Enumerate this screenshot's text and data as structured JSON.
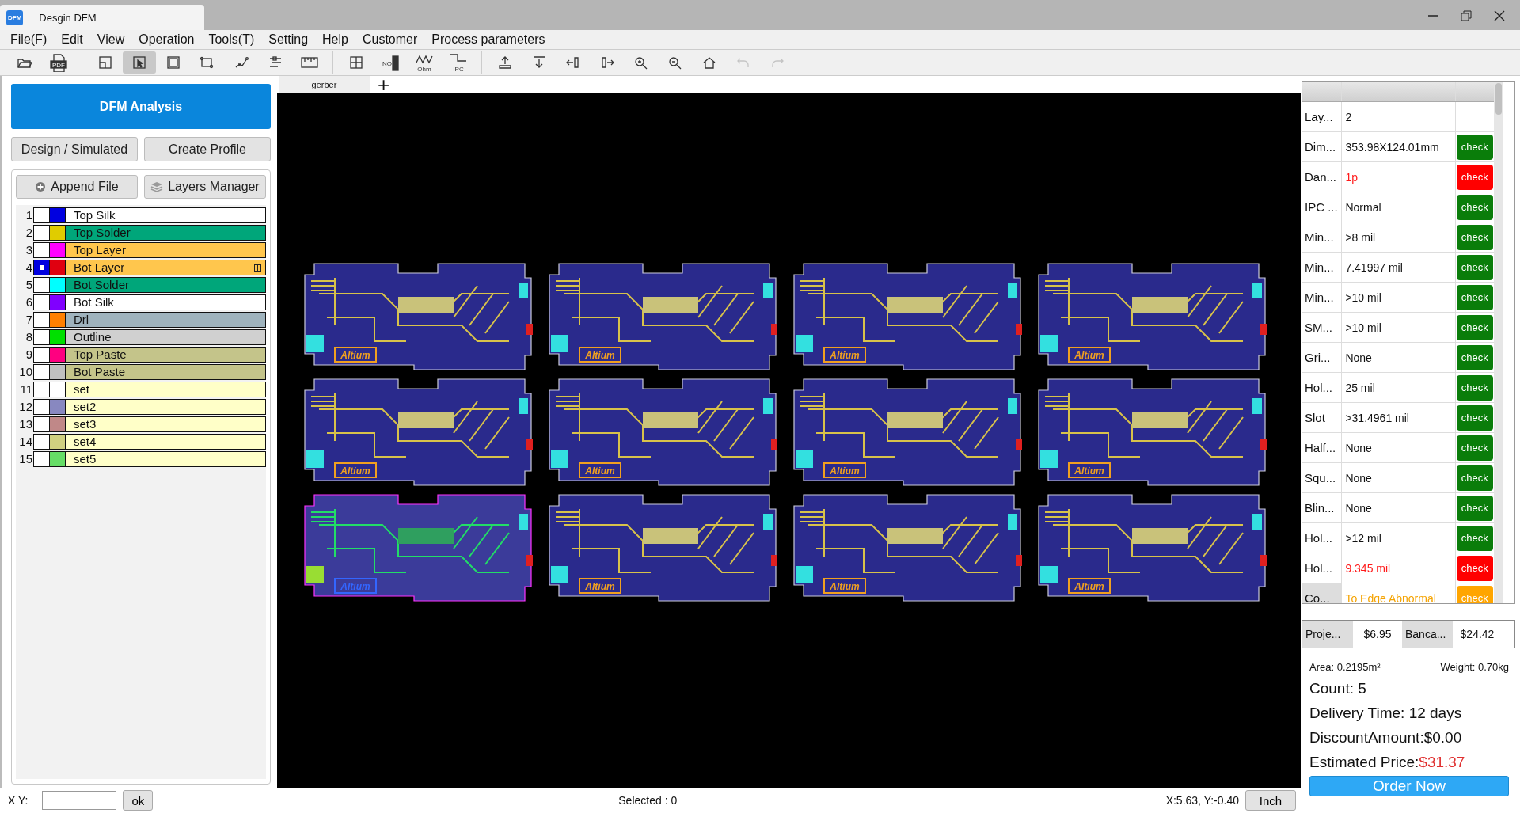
{
  "window": {
    "app_badge": "DFM",
    "title": "Desgin DFM"
  },
  "menu": [
    "File(F)",
    "Edit",
    "View",
    "Operation",
    "Tools(T)",
    "Setting",
    "Help",
    "Customer",
    "Process parameters"
  ],
  "toolbar": [
    [
      {
        "selected": false,
        "disabled": false
      },
      {
        "text": "PDF",
        "selected": false,
        "disabled": false
      }
    ],
    [
      {
        "selected": false,
        "disabled": false
      },
      {
        "selected": true,
        "disabled": false
      },
      {
        "selected": false,
        "disabled": false
      },
      {
        "selected": false,
        "disabled": false
      },
      {
        "selected": false,
        "disabled": false
      },
      {
        "selected": false,
        "disabled": false
      },
      {
        "selected": false,
        "disabled": false
      }
    ],
    [
      {
        "selected": false,
        "disabled": false
      },
      {
        "text": "NO",
        "selected": false,
        "disabled": false
      },
      {
        "text": "Ohm",
        "selected": false,
        "disabled": false
      },
      {
        "text": "IPC",
        "selected": false,
        "disabled": false
      }
    ],
    [
      {
        "selected": false,
        "disabled": false
      },
      {
        "selected": false,
        "disabled": false
      },
      {
        "selected": false,
        "disabled": false
      },
      {
        "selected": false,
        "disabled": false
      },
      {
        "selected": false,
        "disabled": false
      },
      {
        "selected": false,
        "disabled": false
      },
      {
        "selected": false,
        "disabled": false
      },
      {
        "selected": false,
        "disabled": true
      },
      {
        "selected": false,
        "disabled": true
      }
    ]
  ],
  "left_panel": {
    "primary_button": "DFM Analysis",
    "buttons": [
      "Design / Simulated",
      "Create Profile"
    ],
    "file_buttons": [
      "Append File",
      "Layers Manager"
    ],
    "layers": [
      {
        "number": "1",
        "name": "Top Silk",
        "color": "#0000e0",
        "kind": "silk",
        "selected": false,
        "expandable": false
      },
      {
        "number": "2",
        "name": "Top Solder",
        "color": "#e0cc00",
        "kind": "solder",
        "selected": false,
        "expandable": false
      },
      {
        "number": "3",
        "name": "Top Layer",
        "color": "#ff00ff",
        "kind": "copper",
        "selected": false,
        "expandable": false
      },
      {
        "number": "4",
        "name": "Bot Layer",
        "color": "#e00010",
        "kind": "copper",
        "selected": true,
        "expandable": true
      },
      {
        "number": "5",
        "name": "Bot Solder",
        "color": "#00ffff",
        "kind": "solder",
        "selected": false,
        "expandable": false
      },
      {
        "number": "6",
        "name": "Bot Silk",
        "color": "#8000ff",
        "kind": "silk",
        "selected": false,
        "expandable": false
      },
      {
        "number": "7",
        "name": "Drl",
        "color": "#ff8000",
        "kind": "drill",
        "selected": false,
        "expandable": false
      },
      {
        "number": "8",
        "name": "Outline",
        "color": "#00e000",
        "kind": "outline",
        "selected": false,
        "expandable": false
      },
      {
        "number": "9",
        "name": "Top Paste",
        "color": "#ff0080",
        "kind": "paste",
        "selected": false,
        "expandable": false
      },
      {
        "number": "10",
        "name": "Bot Paste",
        "color": "#c0c0c0",
        "kind": "paste",
        "selected": false,
        "expandable": false
      },
      {
        "number": "11",
        "name": "set",
        "color": "#ffffff",
        "kind": "set",
        "selected": false,
        "expandable": false
      },
      {
        "number": "12",
        "name": "set2",
        "color": "#8888c0",
        "kind": "set",
        "selected": false,
        "expandable": false
      },
      {
        "number": "13",
        "name": "set3",
        "color": "#c08888",
        "kind": "set",
        "selected": false,
        "expandable": false
      },
      {
        "number": "14",
        "name": "set4",
        "color": "#d0d080",
        "kind": "set",
        "selected": false,
        "expandable": false
      },
      {
        "number": "15",
        "name": "set5",
        "color": "#66dd66",
        "kind": "set",
        "selected": false,
        "expandable": false
      }
    ]
  },
  "canvas": {
    "tab": "gerber",
    "add_tab": "+",
    "boards": [
      {
        "label": "Altium",
        "selected": false
      },
      {
        "label": "Altium",
        "selected": false
      },
      {
        "label": "Altium",
        "selected": false
      },
      {
        "label": "Altium",
        "selected": false
      },
      {
        "label": "Altium",
        "selected": false
      },
      {
        "label": "Altium",
        "selected": false
      },
      {
        "label": "Altium",
        "selected": false
      },
      {
        "label": "Altium",
        "selected": false
      },
      {
        "label": "Altium",
        "selected": true
      },
      {
        "label": "Altium",
        "selected": false
      },
      {
        "label": "Altium",
        "selected": false
      },
      {
        "label": "Altium",
        "selected": false
      }
    ]
  },
  "checks": [
    {
      "name": "Lay...",
      "value": "2",
      "kind": "info",
      "selected": false
    },
    {
      "name": "Dim...",
      "value": "353.98X124.01mm",
      "kind": "pass",
      "button": "check",
      "selected": false
    },
    {
      "name": "Dan...",
      "value": "1p",
      "kind": "fail",
      "button": "check",
      "selected": false
    },
    {
      "name": "IPC ...",
      "value": "Normal",
      "kind": "pass",
      "button": "check",
      "selected": false
    },
    {
      "name": "Min...",
      "value": ">8 mil",
      "kind": "pass",
      "button": "check",
      "selected": false
    },
    {
      "name": "Min...",
      "value": "7.41997 mil",
      "kind": "pass",
      "button": "check",
      "selected": false
    },
    {
      "name": "Min...",
      "value": ">10 mil",
      "kind": "pass",
      "button": "check",
      "selected": false
    },
    {
      "name": "SM...",
      "value": ">10 mil",
      "kind": "pass",
      "button": "check",
      "selected": false
    },
    {
      "name": "Gri...",
      "value": "None",
      "kind": "pass",
      "button": "check",
      "selected": false
    },
    {
      "name": "Hol...",
      "value": "25 mil",
      "kind": "pass",
      "button": "check",
      "selected": false
    },
    {
      "name": "Slot",
      "value": ">31.4961 mil",
      "kind": "pass",
      "button": "check",
      "selected": false
    },
    {
      "name": "Half...",
      "value": "None",
      "kind": "pass",
      "button": "check",
      "selected": false
    },
    {
      "name": "Squ...",
      "value": "None",
      "kind": "pass",
      "button": "check",
      "selected": false
    },
    {
      "name": "Blin...",
      "value": "None",
      "kind": "pass",
      "button": "check",
      "selected": false
    },
    {
      "name": "Hol...",
      "value": ">12 mil",
      "kind": "pass",
      "button": "check",
      "selected": false
    },
    {
      "name": "Hol...",
      "value": "9.345 mil",
      "kind": "fail",
      "button": "check",
      "selected": false
    },
    {
      "name": "Co...",
      "value": "To Edge Abnormal",
      "kind": "warn",
      "button": "check",
      "selected": true
    }
  ],
  "prices": [
    {
      "label": "Proje...",
      "value": "$6.95"
    },
    {
      "label": "Banca...",
      "value": "$24.42"
    }
  ],
  "summary": {
    "area": "Area: 0.2195m²",
    "weight": "Weight: 0.70kg",
    "count": "Count: 5",
    "delivery": "Delivery Time: 12 days",
    "discount": "DiscountAmount:$0.00",
    "price_label": "Estimated Price:",
    "price": "$31.37",
    "order_button": "Order Now"
  },
  "status_bar": {
    "xy_label": "X Y:",
    "ok_button": "ok",
    "selected": "Selected : 0",
    "coords": "X:5.63, Y:-0.40",
    "unit_button": "Inch"
  }
}
